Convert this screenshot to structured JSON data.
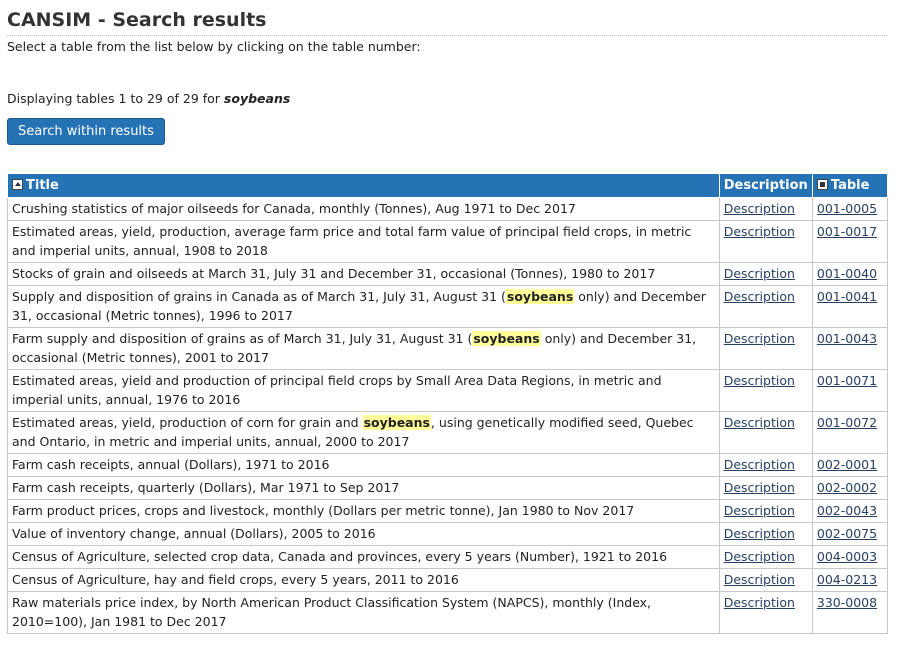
{
  "page": {
    "title": "CANSIM - Search results",
    "instruction": "Select a table from the list below by clicking on the table number:",
    "displaying_prefix": "Displaying tables 1 to 29 of 29 for ",
    "search_term": "soybeans",
    "search_button": "Search within results"
  },
  "table": {
    "headers": {
      "title": "Title",
      "description": "Description",
      "table": "Table"
    },
    "rows": [
      {
        "title_before": "Crushing statistics of major oilseeds for Canada, monthly (Tonnes), Aug 1971 to Dec 2017",
        "highlight": "",
        "title_after": "",
        "description": "Description",
        "table": "001-0005"
      },
      {
        "title_before": "Estimated areas, yield, production, average farm price and total farm value of principal field crops, in metric and imperial units, annual, 1908 to 2018",
        "highlight": "",
        "title_after": "",
        "description": "Description",
        "table": "001-0017"
      },
      {
        "title_before": "Stocks of grain and oilseeds at March 31, July 31 and December 31, occasional (Tonnes), 1980 to 2017",
        "highlight": "",
        "title_after": "",
        "description": "Description",
        "table": "001-0040"
      },
      {
        "title_before": "Supply and disposition of grains in Canada as of March 31, July 31, August 31 (",
        "highlight": "soybeans",
        "title_after": " only) and December 31, occasional (Metric tonnes), 1996 to 2017",
        "description": "Description",
        "table": "001-0041"
      },
      {
        "title_before": "Farm supply and disposition of grains as of March 31, July 31, August 31 (",
        "highlight": "soybeans",
        "title_after": " only) and December 31, occasional (Metric tonnes), 2001 to 2017",
        "description": "Description",
        "table": "001-0043"
      },
      {
        "title_before": "Estimated areas, yield and production of principal field crops by Small Area Data Regions, in metric and imperial units, annual, 1976 to 2016",
        "highlight": "",
        "title_after": "",
        "description": "Description",
        "table": "001-0071"
      },
      {
        "title_before": "Estimated areas, yield, production of corn for grain and ",
        "highlight": "soybeans",
        "title_after": ", using genetically modified seed, Quebec and Ontario, in metric and imperial units, annual, 2000 to 2017",
        "description": "Description",
        "table": "001-0072"
      },
      {
        "title_before": "Farm cash receipts, annual (Dollars), 1971 to 2016",
        "highlight": "",
        "title_after": "",
        "description": "Description",
        "table": "002-0001"
      },
      {
        "title_before": "Farm cash receipts, quarterly (Dollars), Mar 1971 to Sep 2017",
        "highlight": "",
        "title_after": "",
        "description": "Description",
        "table": "002-0002"
      },
      {
        "title_before": "Farm product prices, crops and livestock, monthly (Dollars per metric tonne), Jan 1980 to Nov 2017",
        "highlight": "",
        "title_after": "",
        "description": "Description",
        "table": "002-0043"
      },
      {
        "title_before": "Value of inventory change, annual (Dollars), 2005 to 2016",
        "highlight": "",
        "title_after": "",
        "description": "Description",
        "table": "002-0075"
      },
      {
        "title_before": "Census of Agriculture, selected crop data, Canada and provinces, every 5 years (Number), 1921 to 2016",
        "highlight": "",
        "title_after": "",
        "description": "Description",
        "table": "004-0003"
      },
      {
        "title_before": "Census of Agriculture, hay and field crops, every 5 years, 2011 to 2016",
        "highlight": "",
        "title_after": "",
        "description": "Description",
        "table": "004-0213"
      },
      {
        "title_before": "Raw materials price index, by North American Product Classification System (NAPCS), monthly (Index, 2010=100), Jan 1981 to Dec 2017",
        "highlight": "",
        "title_after": "",
        "description": "Description",
        "table": "330-0008"
      }
    ]
  }
}
